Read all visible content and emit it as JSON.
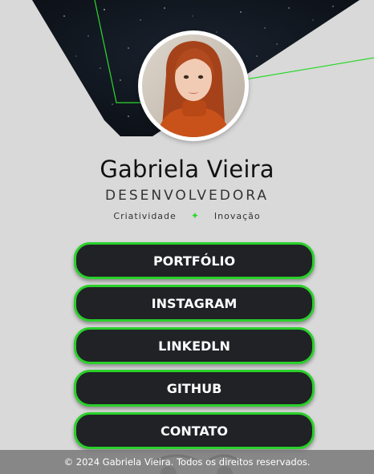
{
  "profile": {
    "name": "Gabriela Vieira",
    "role": "DESENVOLVEDORA",
    "tag_left": "Criatividade",
    "tag_separator": "✦",
    "tag_right": "Inovação"
  },
  "links": [
    {
      "label": "PORTFÓLIO"
    },
    {
      "label": "INSTAGRAM"
    },
    {
      "label": "LINKEDLN"
    },
    {
      "label": "GITHUB"
    },
    {
      "label": "CONTATO"
    }
  ],
  "footer": {
    "text": "© 2024 Gabriela Vieira. Todos os direitos reservados."
  },
  "colors": {
    "background": "#d9d9d9",
    "button_fill": "#202226",
    "button_border": "#2ad02a",
    "accent_line": "#2ed82e",
    "banner": "#10151d"
  },
  "icons": {
    "banner": "starry-space-banner",
    "avatar": "profile-photo"
  }
}
